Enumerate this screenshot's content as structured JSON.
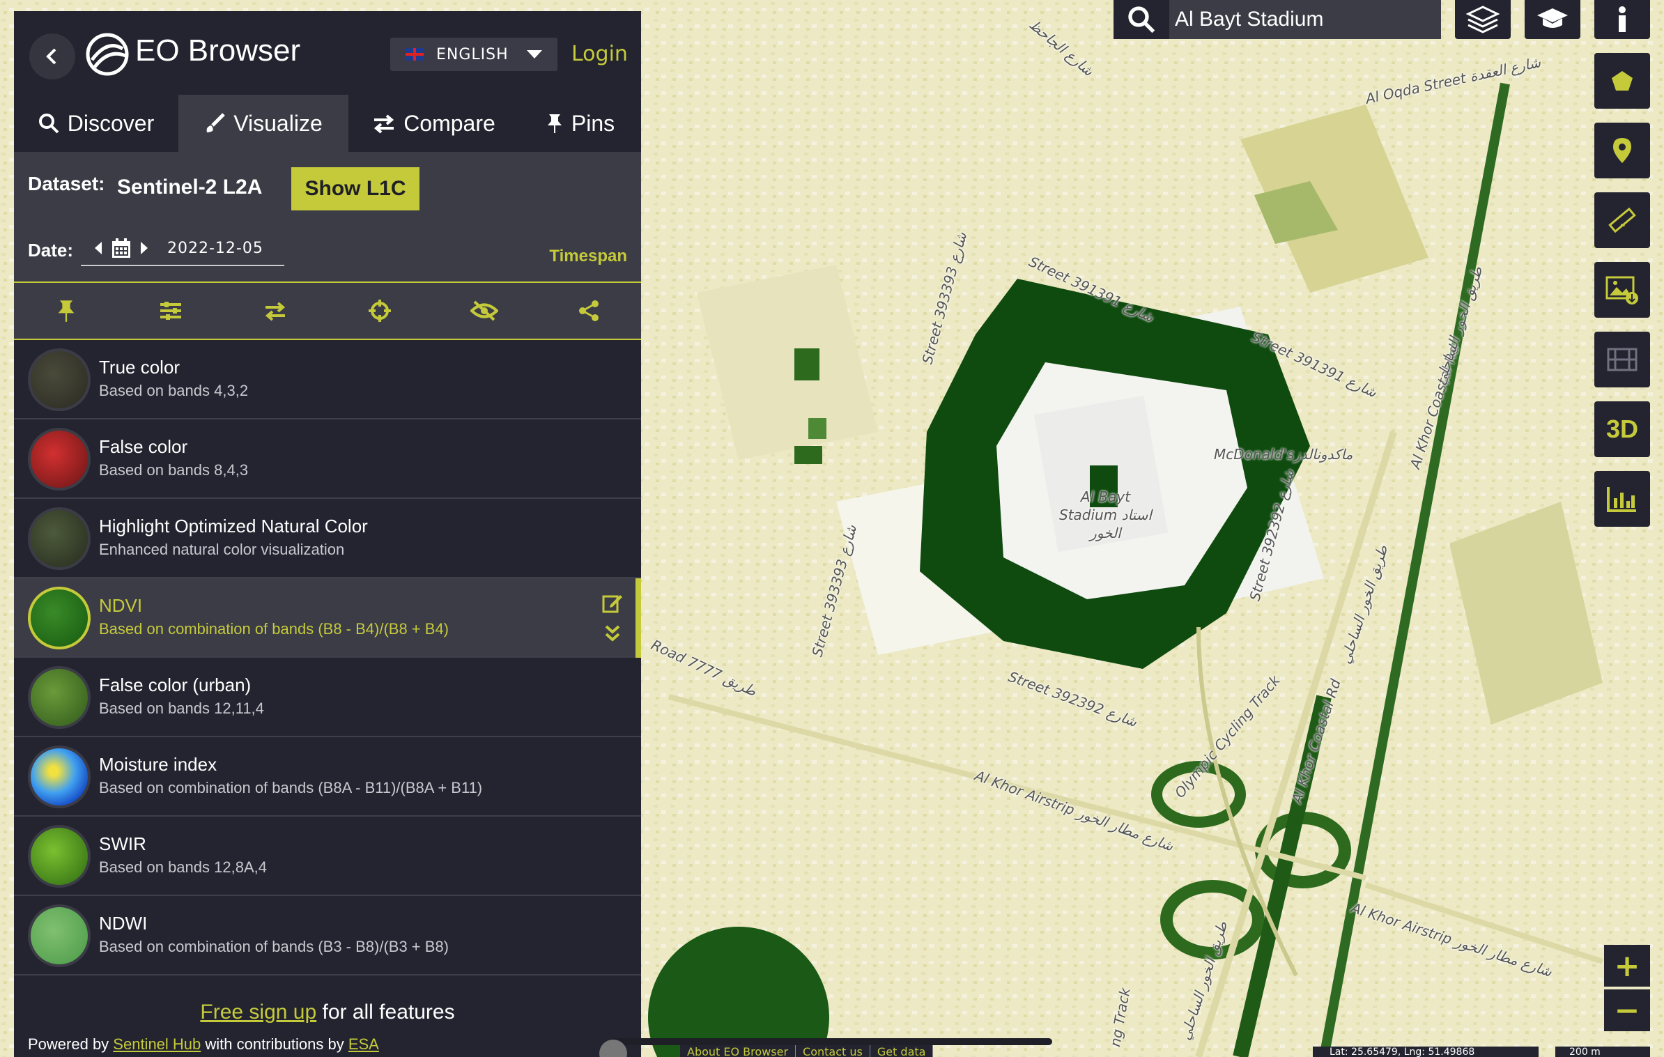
{
  "app": {
    "title": "EO Browser",
    "language": "ENGLISH",
    "login": "Login"
  },
  "tabs": [
    {
      "label": "Discover",
      "icon": "search-icon"
    },
    {
      "label": "Visualize",
      "icon": "brush-icon"
    },
    {
      "label": "Compare",
      "icon": "compare-arrows-icon"
    },
    {
      "label": "Pins",
      "icon": "pin-icon"
    }
  ],
  "dataset": {
    "label": "Dataset:",
    "value": "Sentinel-2 L2A",
    "show_l1c": "Show L1C"
  },
  "date": {
    "label": "Date:",
    "value": "2022-12-05",
    "timespan": "Timespan"
  },
  "toolbar": {
    "icons": [
      "pin-icon",
      "sliders-icon",
      "compare-icon",
      "crosshair-icon",
      "eye-slash-icon",
      "share-icon"
    ]
  },
  "layers": [
    {
      "title": "True color",
      "subtitle": "Based on bands 4,3,2"
    },
    {
      "title": "False color",
      "subtitle": "Based on bands 8,4,3"
    },
    {
      "title": "Highlight Optimized Natural Color",
      "subtitle": "Enhanced natural color visualization"
    },
    {
      "title": "NDVI",
      "subtitle": "Based on combination of bands (B8 - B4)/(B8 + B4)",
      "selected": true
    },
    {
      "title": "False color (urban)",
      "subtitle": "Based on bands 12,11,4"
    },
    {
      "title": "Moisture index",
      "subtitle": "Based on combination of bands (B8A - B11)/(B8A + B11)"
    },
    {
      "title": "SWIR",
      "subtitle": "Based on bands 12,8A,4"
    },
    {
      "title": "NDWI",
      "subtitle": "Based on combination of bands (B3 - B8)/(B3 + B8)"
    }
  ],
  "footer": {
    "signup_link": "Free sign up",
    "signup_rest": " for all features",
    "powered_prefix": "Powered by ",
    "sentinel_hub": "Sentinel Hub",
    "powered_mid": " with contributions by ",
    "esa": "ESA"
  },
  "search": {
    "value": "Al Bayt Stadium"
  },
  "map_labels": {
    "al_oqda": "Al Oqda Street",
    "al_oqda_ar": "شارع العقدة",
    "street_391391_a": "Street 391391",
    "street_391391_a_ar": "شارع",
    "street_391391_b": "Street 391391",
    "street_391391_b_ar": "شارع",
    "street_393393": "Street 393393",
    "street_393393_ar": "شارع",
    "street_393393_b": "Street 393393",
    "street_393393_b_ar": "شارع",
    "mcdonalds": "McDonald's",
    "mcdonalds_ar": "ماكدونالدز",
    "stadium_1": "Al Bayt",
    "stadium_2": "Stadium",
    "stadium_ar": "استاد",
    "stadium_ar2": "الخور",
    "street_392392_a": "Street 392392",
    "street_392392_a_ar": "شارع",
    "street_392392_b": "Street 392392",
    "street_392392_b_ar": "شارع",
    "road_7777": "Road 7777",
    "road_7777_ar": "طريق",
    "al_khor_airstrip_a": "Al Khor Airstrip",
    "al_khor_airstrip_a_ar": "شارع مطار الخور",
    "al_khor_airstrip_b": "Al Khor Airstrip",
    "al_khor_airstrip_b_ar": "شارع مطار الخور",
    "olympic": "Olympic Cycling Track",
    "coastal_a": "Al Khor Coastal Rd",
    "coastal_b": "Al Khor Coastal Rd",
    "coastal_ar_a": "طريق الخور الساحلي",
    "coastal_ar_b": "طريق الخور الساحلي",
    "coastal_ar_c": "طريق الخور الساحلي",
    "track": "ng Track",
    "top_ar": "شارع الجاحظ"
  },
  "bottom_bar": {
    "links": [
      "About EO Browser",
      "Contact us",
      "Get data"
    ],
    "coords": "Lat: 25.65479, Lng: 51.49868",
    "scale": "200 m"
  },
  "colors": {
    "accent": "#c5ca3b",
    "panel_bg": "#23242f",
    "panel_bg_light": "#3b3c46",
    "map_light": "#efeccc",
    "ndvi_dark": "#0f4a0f"
  }
}
